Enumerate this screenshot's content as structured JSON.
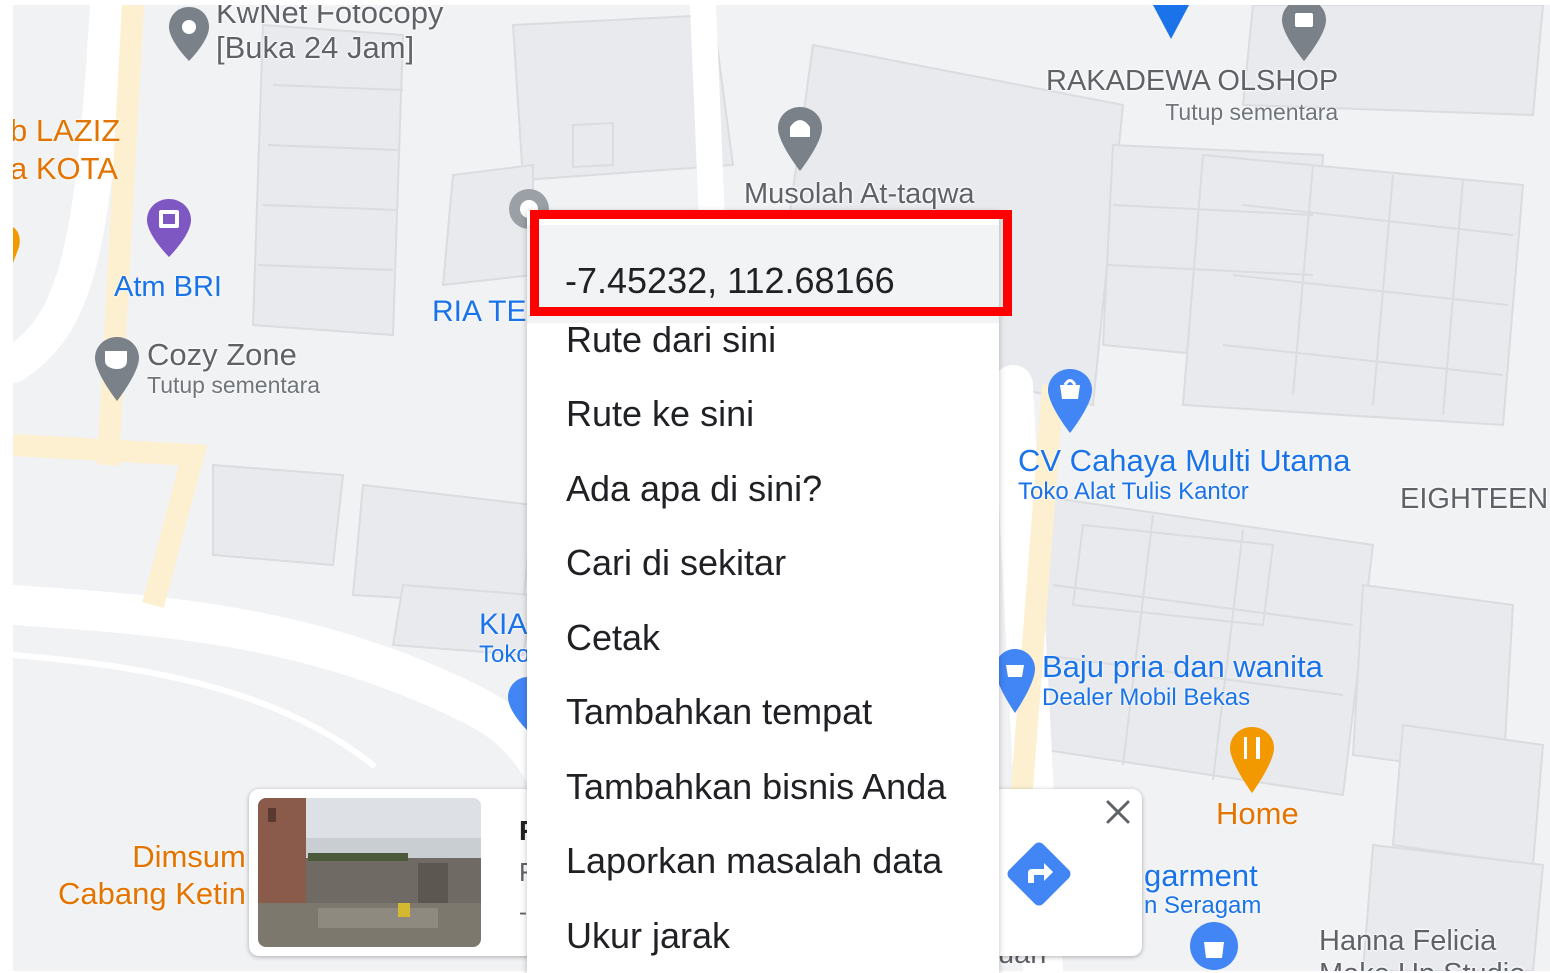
{
  "map": {
    "places": [
      {
        "name_line1": "KwNet Fotocopy",
        "name_line2": "[Buka 24 Jam]"
      },
      {
        "name_line1": "b LAZIZ",
        "name_line2": "a KOTA"
      },
      {
        "name": "Atm BRI"
      },
      {
        "name": "Cozy Zone",
        "sub": "Tutup sementara"
      },
      {
        "name": "Musolah At-taqwa"
      },
      {
        "name": "RAKADEWA OLSHOP",
        "sub": "Tutup sementara"
      },
      {
        "name": "RIA TE"
      },
      {
        "name": "CV Cahaya Multi Utama",
        "sub": "Toko Alat Tulis Kantor"
      },
      {
        "name": "EIGHTEEN"
      },
      {
        "name": "KIA",
        "sub": "Toko"
      },
      {
        "name": "Baju pria dan wanita",
        "sub": "Dealer Mobil Bekas"
      },
      {
        "name": "Home"
      },
      {
        "name": "garment",
        "sub": "n Seragam"
      },
      {
        "name_line1": "Dimsum",
        "name_line2": "Cabang Ketin"
      },
      {
        "name_line1": "Hanna Felicia",
        "name_line2": "Make Up Studio"
      },
      {
        "name": "uan"
      }
    ]
  },
  "context_menu": {
    "coordinates": "-7.45232, 112.68166",
    "items": [
      "Rute dari sini",
      "Rute ke sini",
      "Ada apa di sini?",
      "Cari di sekitar",
      "Cetak",
      "Tambahkan tempat",
      "Tambahkan bisnis Anda",
      "Laporkan masalah data",
      "Ukur jarak"
    ]
  },
  "info_card": {
    "title_initial": "F",
    "line2_initial": "F",
    "line3_initial": "-"
  },
  "icons": {
    "close": "close-icon",
    "directions": "directions-icon",
    "photo": "place-photo"
  },
  "colors": {
    "highlight": "#ff0000",
    "map_bg": "#f1f2f4",
    "road": "#ffffff",
    "poi_blue": "#1a73e8",
    "poi_orange": "#e37400",
    "poi_grey": "#5f6368"
  }
}
